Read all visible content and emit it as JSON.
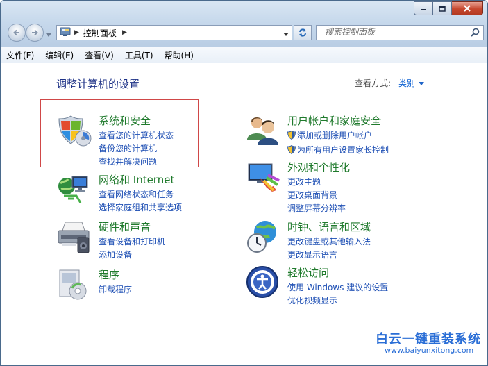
{
  "window": {
    "buttons": [
      "minimize",
      "maximize",
      "close"
    ]
  },
  "address": {
    "crumb": "控制面板"
  },
  "search": {
    "placeholder": "搜索控制面板"
  },
  "menu": {
    "items": [
      "文件(F)",
      "编辑(E)",
      "查看(V)",
      "工具(T)",
      "帮助(H)"
    ]
  },
  "content": {
    "heading": "调整计算机的设置",
    "view_by_label": "查看方式:",
    "view_by_value": "类别"
  },
  "categories": [
    {
      "title": "系统和安全",
      "icon": "shield-icon",
      "links": [
        "查看您的计算机状态",
        "备份您的计算机",
        "查找并解决问题"
      ]
    },
    {
      "title": "网络和 Internet",
      "icon": "network-icon",
      "links": [
        "查看网络状态和任务",
        "选择家庭组和共享选项"
      ]
    },
    {
      "title": "硬件和声音",
      "icon": "printer-icon",
      "links": [
        "查看设备和打印机",
        "添加设备"
      ]
    },
    {
      "title": "程序",
      "icon": "programs-icon",
      "links": [
        "卸载程序"
      ]
    },
    {
      "title": "用户帐户和家庭安全",
      "icon": "users-icon",
      "links": [
        "添加或删除用户帐户",
        "为所有用户设置家长控制"
      ]
    },
    {
      "title": "外观和个性化",
      "icon": "appearance-icon",
      "links": [
        "更改主题",
        "更改桌面背景",
        "调整屏幕分辨率"
      ]
    },
    {
      "title": "时钟、语言和区域",
      "icon": "clock-globe-icon",
      "links": [
        "更改键盘或其他输入法",
        "更改显示语言"
      ]
    },
    {
      "title": "轻松访问",
      "icon": "ease-of-access-icon",
      "links": [
        "使用 Windows 建议的设置",
        "优化视频显示"
      ]
    }
  ],
  "watermark": {
    "title": "白云一键重装系统",
    "url": "www.baiyunxitong.com"
  },
  "colors": {
    "category_title": "#1f7a2c",
    "link": "#1e4fb4",
    "heading": "#1e3287",
    "highlight_box": "#d04848"
  }
}
